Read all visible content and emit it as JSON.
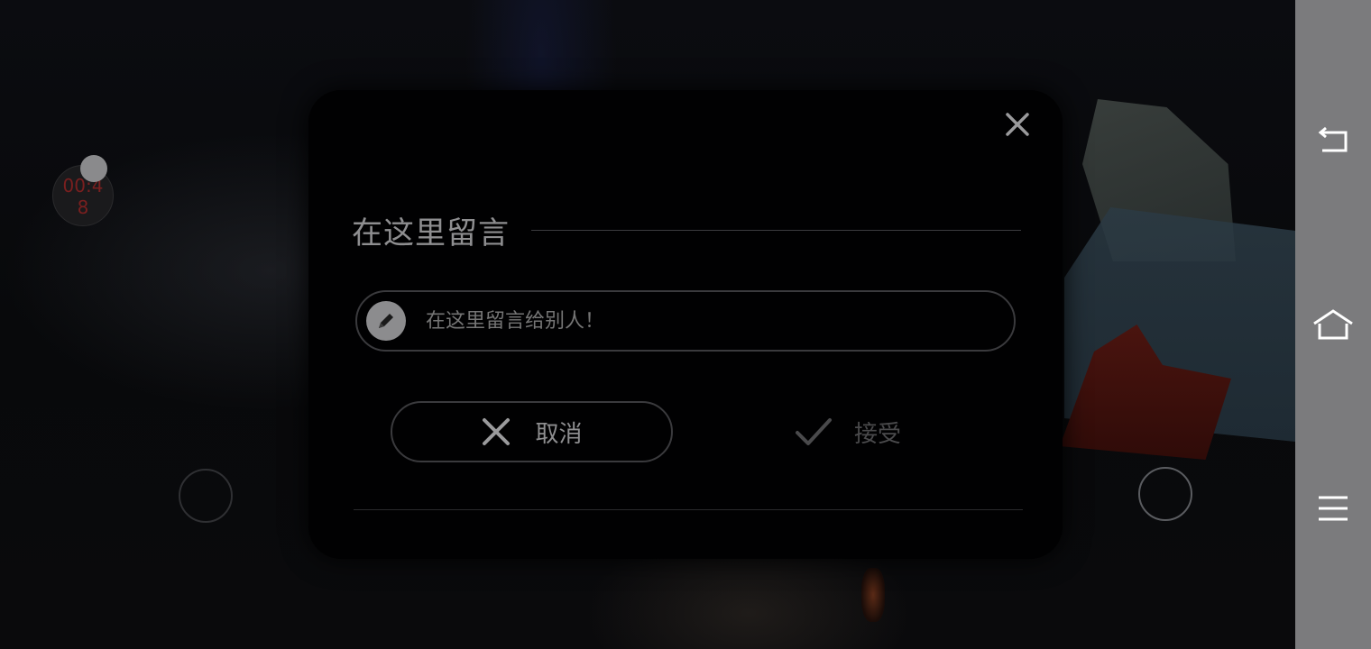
{
  "timer": {
    "text": "00:4\n8"
  },
  "dialog": {
    "title": "在这里留言",
    "input_placeholder": "在这里留言给别人！",
    "cancel_label": "取消",
    "accept_label": "接受"
  },
  "icons": {
    "close": "close-icon",
    "pencil": "pencil-icon",
    "cancel": "x-icon",
    "accept": "checkmark-icon",
    "nav_back": "back-icon",
    "nav_home": "home-icon",
    "nav_menu": "menu-icon"
  },
  "colors": {
    "dialog_bg": "#010102",
    "text_primary": "#8e8e90",
    "text_dim": "#4a4a4c",
    "navbar_bg": "#7b7b7d"
  }
}
